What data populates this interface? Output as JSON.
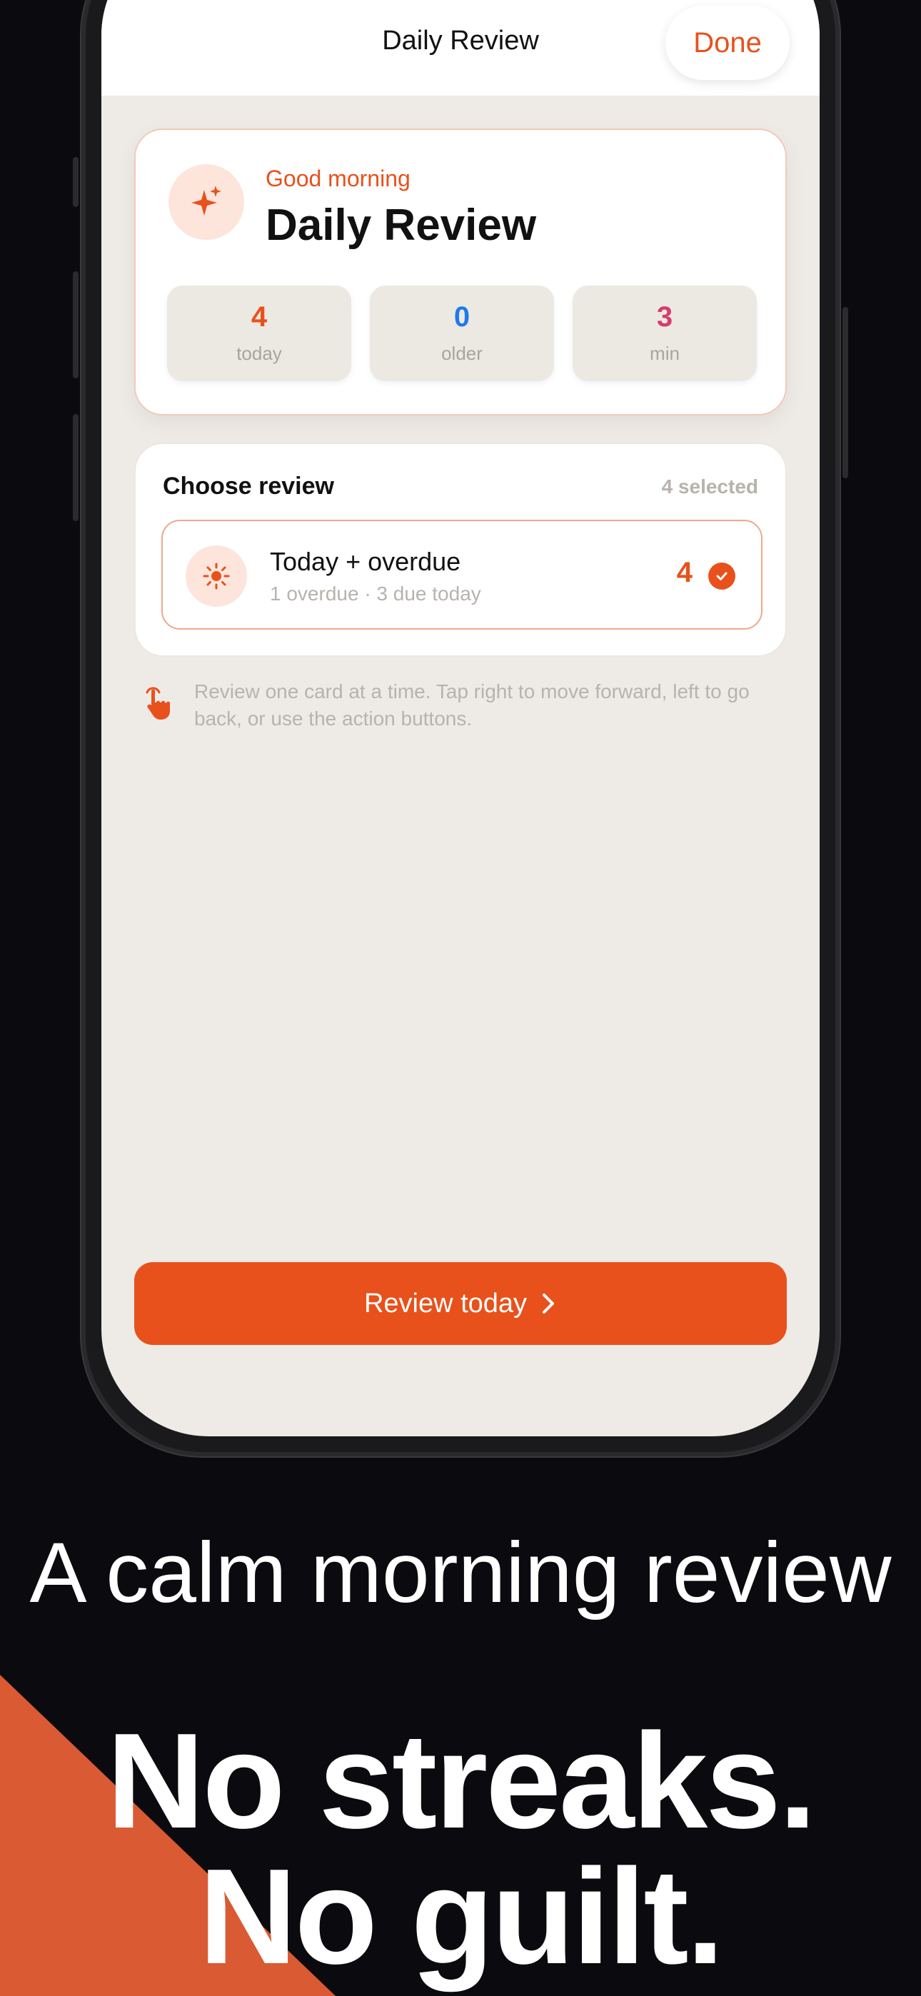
{
  "navbar": {
    "title": "Daily Review",
    "done_label": "Done"
  },
  "hero": {
    "greeting": "Good morning",
    "title": "Daily Review",
    "icon": "sparkle-icon",
    "stats": [
      {
        "value": "4",
        "label": "today",
        "color": "#e8511c"
      },
      {
        "value": "0",
        "label": "older",
        "color": "#1f7aeb"
      },
      {
        "value": "3",
        "label": "min",
        "color": "#d83a6e"
      }
    ]
  },
  "choose": {
    "title": "Choose review",
    "selected_count": "4 selected",
    "option": {
      "icon": "sun-icon",
      "title": "Today + overdue",
      "subtitle": "1 overdue · 3 due today",
      "count": "4",
      "checked": true
    }
  },
  "hint": {
    "icon": "tap-hand-icon",
    "text": "Review one card at a time. Tap right to move forward, left to go back, or use the action buttons."
  },
  "cta": {
    "label": "Review today",
    "icon": "chevron-right-icon"
  },
  "marketing": {
    "tagline": "A calm morning review",
    "headline_line1": "No streaks.",
    "headline_line2": "No guilt."
  },
  "colors": {
    "accent": "#e8511c",
    "background": "#0b0b0f",
    "screen": "#eeebe7"
  }
}
